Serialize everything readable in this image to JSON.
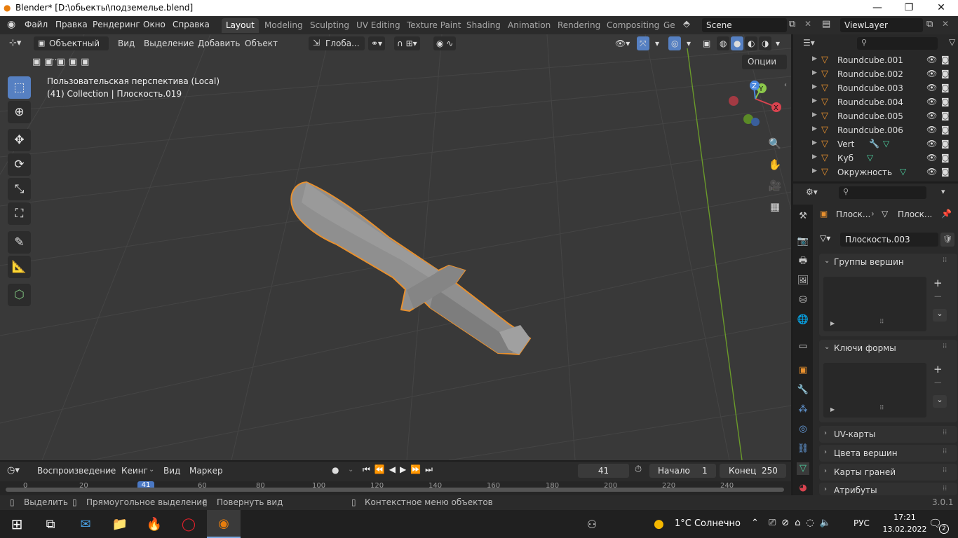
{
  "window": {
    "title": "Blender* [D:\\обьекты\\подземелье.blend]",
    "minimize": "—",
    "maximize": "❐",
    "close": "✕"
  },
  "menu": {
    "file": "Файл",
    "edit": "Правка",
    "render": "Рендеринг",
    "window": "Окно",
    "help": "Справка"
  },
  "workspaces": [
    "Layout",
    "Modeling",
    "Sculpting",
    "UV Editing",
    "Texture Paint",
    "Shading",
    "Animation",
    "Rendering",
    "Compositing",
    "Ge"
  ],
  "scene": {
    "name": "Scene",
    "view_layer": "ViewLayer"
  },
  "viewport_header": {
    "mode": "Объектный ...",
    "view": "Вид",
    "select": "Выделение",
    "add": "Добавить",
    "object": "Объект",
    "transform": "Глоба...",
    "options": "Опции"
  },
  "viewport_info": {
    "line1": "Пользовательская перспектива (Local)",
    "line2": "(41) Collection | Плоскость.019"
  },
  "gizmo": {
    "x": "X",
    "y": "Y",
    "z": "Z"
  },
  "outliner": {
    "items": [
      {
        "name": "Roundcube.001"
      },
      {
        "name": "Roundcube.002"
      },
      {
        "name": "Roundcube.003"
      },
      {
        "name": "Roundcube.004"
      },
      {
        "name": "Roundcube.005"
      },
      {
        "name": "Roundcube.006"
      },
      {
        "name": "Vert"
      },
      {
        "name": "Куб"
      },
      {
        "name": "Окружность"
      }
    ]
  },
  "properties": {
    "breadcrumb_a": "Плоск...",
    "breadcrumb_b": "Плоск...",
    "mesh_name": "Плоскость.003",
    "panels": {
      "vertex_groups": "Группы вершин",
      "shape_keys": "Ключи формы",
      "uv_maps": "UV-карты",
      "vertex_colors": "Цвета вершин",
      "face_maps": "Карты граней",
      "attributes": "Атрибуты"
    }
  },
  "timeline": {
    "playback": "Воспроизведение",
    "keying": "Кеинг",
    "view": "Вид",
    "marker": "Маркер",
    "current_frame": "41",
    "start_label": "Начало",
    "start": "1",
    "end_label": "Конец",
    "end": "250",
    "ruler": [
      "0",
      "20",
      "41",
      "60",
      "80",
      "100",
      "120",
      "140",
      "160",
      "180",
      "200",
      "220",
      "240"
    ]
  },
  "statusbar": {
    "select": "Выделить",
    "box_select": "Прямоугольное выделение",
    "rotate": "Повернуть вид",
    "context": "Контекстное меню объектов",
    "version": "3.0.1"
  },
  "taskbar": {
    "weather": "1°C  Солнечно",
    "lang": "РУС",
    "time": "17:21",
    "date": "13.02.2022",
    "notifications": "2"
  },
  "colors": {
    "accent": "#5680c2",
    "selection": "#e8902e",
    "background": "#393939"
  }
}
